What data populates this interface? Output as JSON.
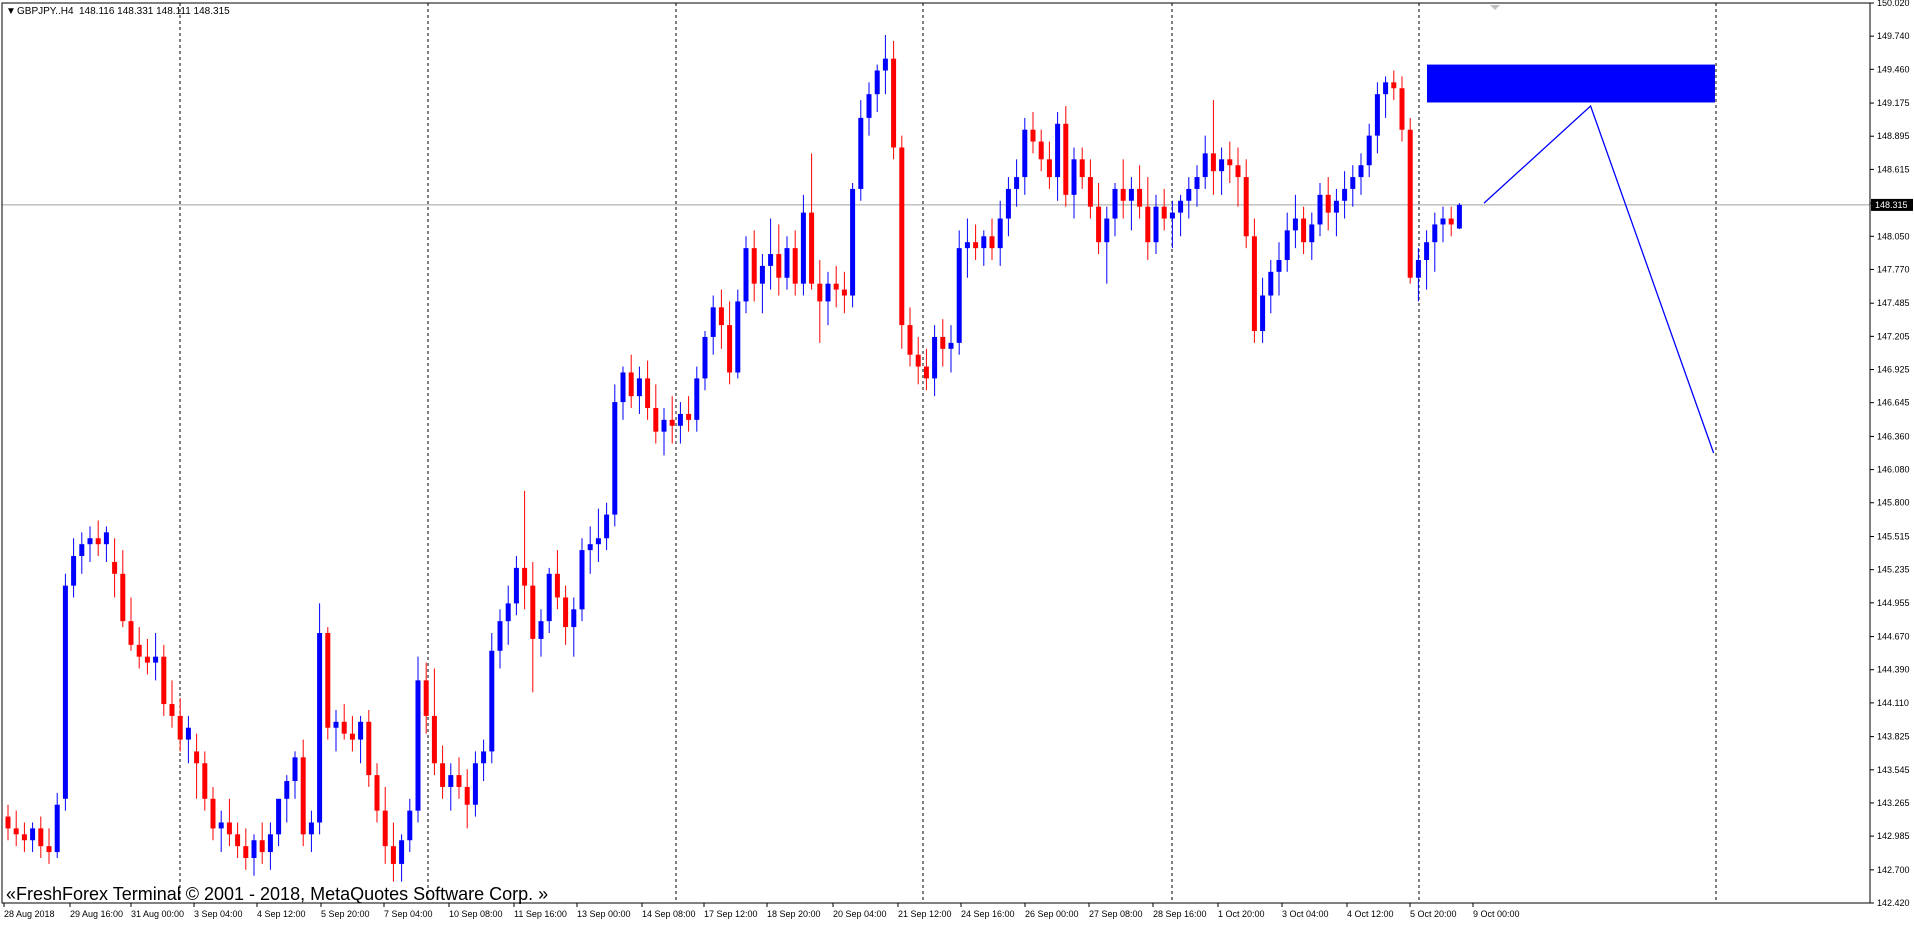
{
  "header": {
    "symbol": "GBPJPY..H4",
    "ohlc": "148.116 148.331 148.111 148.315"
  },
  "copyright": "«FreshForex Terminal © 2001 - 2018, MetaQuotes Software Corp. »",
  "colors": {
    "bull": "#0000ff",
    "bear": "#ff0000",
    "grid": "#000000",
    "bid_line": "#a0a0a0",
    "zone": "#0000ff",
    "forecast": "#0000ff",
    "price_label_bg": "#000000",
    "price_label_fg": "#ffffff"
  },
  "chart_data": {
    "type": "candlestick",
    "timeframe": "H4",
    "ylim": [
      142.42,
      150.02
    ],
    "y_ticks": [
      "150.020",
      "149.740",
      "149.460",
      "149.175",
      "148.895",
      "148.615",
      "148.330",
      "148.050",
      "147.770",
      "147.485",
      "147.205",
      "146.925",
      "146.645",
      "146.360",
      "146.080",
      "145.800",
      "145.515",
      "145.235",
      "144.955",
      "144.670",
      "144.390",
      "144.110",
      "143.825",
      "143.545",
      "143.265",
      "142.985",
      "142.700",
      "142.420"
    ],
    "current_price": "148.315",
    "x_labels": [
      "28 Aug 2018",
      "29 Aug 16:00",
      "31 Aug 00:00",
      "3 Sep 04:00",
      "4 Sep 12:00",
      "5 Sep 20:00",
      "7 Sep 04:00",
      "10 Sep 08:00",
      "11 Sep 16:00",
      "13 Sep 00:00",
      "14 Sep 08:00",
      "17 Sep 12:00",
      "18 Sep 20:00",
      "20 Sep 04:00",
      "21 Sep 12:00",
      "24 Sep 16:00",
      "26 Sep 00:00",
      "27 Sep 08:00",
      "28 Sep 16:00",
      "1 Oct 20:00",
      "3 Oct 04:00",
      "4 Oct 12:00",
      "5 Oct 20:00",
      "9 Oct 00:00"
    ],
    "candles": [
      [
        143.15,
        143.25,
        142.95,
        143.05
      ],
      [
        143.05,
        143.2,
        142.9,
        143.0
      ],
      [
        143.0,
        143.1,
        142.85,
        142.95
      ],
      [
        142.95,
        143.1,
        142.85,
        143.05
      ],
      [
        143.05,
        143.15,
        142.8,
        142.9
      ],
      [
        142.9,
        143.05,
        142.75,
        142.85
      ],
      [
        142.85,
        143.35,
        142.8,
        143.25
      ],
      [
        143.3,
        145.2,
        143.2,
        145.1
      ],
      [
        145.1,
        145.5,
        145.0,
        145.35
      ],
      [
        145.35,
        145.55,
        145.2,
        145.45
      ],
      [
        145.45,
        145.6,
        145.3,
        145.5
      ],
      [
        145.5,
        145.65,
        145.35,
        145.45
      ],
      [
        145.45,
        145.6,
        145.3,
        145.55
      ],
      [
        145.3,
        145.5,
        145.0,
        145.2
      ],
      [
        145.2,
        145.4,
        144.75,
        144.8
      ],
      [
        144.8,
        145.0,
        144.55,
        144.6
      ],
      [
        144.6,
        144.75,
        144.4,
        144.5
      ],
      [
        144.5,
        144.65,
        144.35,
        144.45
      ],
      [
        144.45,
        144.7,
        144.3,
        144.5
      ],
      [
        144.5,
        144.6,
        144.0,
        144.1
      ],
      [
        144.1,
        144.3,
        143.9,
        144.0
      ],
      [
        144.0,
        144.15,
        143.7,
        143.8
      ],
      [
        143.8,
        144.0,
        143.6,
        143.9
      ],
      [
        143.7,
        143.85,
        143.3,
        143.6
      ],
      [
        143.6,
        143.7,
        143.2,
        143.3
      ],
      [
        143.3,
        143.4,
        142.95,
        143.05
      ],
      [
        143.05,
        143.2,
        142.85,
        143.1
      ],
      [
        143.1,
        143.3,
        142.9,
        143.0
      ],
      [
        143.0,
        143.1,
        142.8,
        142.9
      ],
      [
        142.9,
        143.05,
        142.7,
        142.8
      ],
      [
        142.8,
        143.0,
        142.65,
        142.95
      ],
      [
        142.95,
        143.1,
        142.75,
        142.85
      ],
      [
        142.85,
        143.1,
        142.7,
        143.0
      ],
      [
        143.0,
        143.2,
        142.9,
        143.3
      ],
      [
        143.3,
        143.5,
        143.1,
        143.45
      ],
      [
        143.45,
        143.7,
        143.3,
        143.65
      ],
      [
        143.65,
        143.8,
        142.9,
        143.0
      ],
      [
        143.0,
        143.2,
        142.85,
        143.1
      ],
      [
        143.1,
        144.95,
        143.0,
        144.7
      ],
      [
        144.7,
        144.75,
        143.8,
        143.9
      ],
      [
        143.9,
        144.05,
        143.7,
        143.95
      ],
      [
        143.95,
        144.1,
        143.8,
        143.85
      ],
      [
        143.85,
        144.0,
        143.7,
        143.8
      ],
      [
        143.8,
        144.0,
        143.6,
        143.95
      ],
      [
        143.95,
        144.05,
        143.4,
        143.5
      ],
      [
        143.5,
        143.6,
        143.1,
        143.2
      ],
      [
        143.2,
        143.4,
        142.75,
        142.9
      ],
      [
        142.9,
        143.1,
        142.6,
        142.75
      ],
      [
        142.75,
        143.0,
        142.6,
        142.95
      ],
      [
        142.95,
        143.3,
        142.85,
        143.2
      ],
      [
        143.2,
        144.5,
        143.1,
        144.3
      ],
      [
        144.3,
        144.45,
        143.85,
        144.0
      ],
      [
        144.0,
        144.4,
        143.5,
        143.6
      ],
      [
        143.6,
        143.75,
        143.3,
        143.4
      ],
      [
        143.4,
        143.6,
        143.2,
        143.5
      ],
      [
        143.5,
        143.65,
        143.3,
        143.4
      ],
      [
        143.4,
        143.55,
        143.05,
        143.25
      ],
      [
        143.25,
        143.7,
        143.15,
        143.6
      ],
      [
        143.6,
        143.8,
        143.45,
        143.7
      ],
      [
        143.7,
        144.7,
        143.6,
        144.55
      ],
      [
        144.55,
        144.9,
        144.4,
        144.8
      ],
      [
        144.8,
        145.1,
        144.6,
        144.95
      ],
      [
        144.95,
        145.35,
        144.85,
        145.25
      ],
      [
        145.25,
        145.9,
        144.9,
        145.1
      ],
      [
        145.1,
        145.3,
        144.2,
        144.65
      ],
      [
        144.65,
        144.9,
        144.5,
        144.8
      ],
      [
        144.8,
        145.25,
        144.7,
        145.2
      ],
      [
        145.2,
        145.4,
        144.9,
        145.0
      ],
      [
        145.0,
        145.1,
        144.6,
        144.75
      ],
      [
        144.75,
        145.0,
        144.5,
        144.9
      ],
      [
        144.9,
        145.5,
        144.8,
        145.4
      ],
      [
        145.4,
        145.6,
        145.2,
        145.45
      ],
      [
        145.45,
        145.75,
        145.3,
        145.5
      ],
      [
        145.5,
        145.8,
        145.4,
        145.7
      ],
      [
        145.7,
        146.8,
        145.6,
        146.65
      ],
      [
        146.65,
        146.95,
        146.5,
        146.9
      ],
      [
        146.9,
        147.05,
        146.6,
        146.7
      ],
      [
        146.7,
        146.95,
        146.55,
        146.85
      ],
      [
        146.85,
        147.0,
        146.5,
        146.6
      ],
      [
        146.6,
        146.8,
        146.3,
        146.4
      ],
      [
        146.4,
        146.6,
        146.2,
        146.5
      ],
      [
        146.5,
        146.7,
        146.3,
        146.45
      ],
      [
        146.45,
        146.65,
        146.3,
        146.55
      ],
      [
        146.55,
        146.7,
        146.4,
        146.5
      ],
      [
        146.5,
        146.95,
        146.4,
        146.85
      ],
      [
        146.85,
        147.25,
        146.75,
        147.2
      ],
      [
        147.2,
        147.55,
        147.05,
        147.45
      ],
      [
        147.45,
        147.6,
        147.1,
        147.3
      ],
      [
        147.3,
        147.5,
        146.8,
        146.9
      ],
      [
        146.9,
        147.6,
        146.85,
        147.5
      ],
      [
        147.5,
        148.05,
        147.4,
        147.95
      ],
      [
        147.95,
        148.1,
        147.5,
        147.65
      ],
      [
        147.65,
        147.9,
        147.4,
        147.8
      ],
      [
        147.8,
        148.2,
        147.6,
        147.9
      ],
      [
        147.9,
        148.15,
        147.55,
        147.7
      ],
      [
        147.7,
        148.05,
        147.6,
        147.95
      ],
      [
        147.95,
        148.1,
        147.55,
        147.65
      ],
      [
        147.65,
        148.4,
        147.55,
        148.25
      ],
      [
        148.25,
        148.75,
        147.6,
        147.65
      ],
      [
        147.65,
        147.85,
        147.15,
        147.5
      ],
      [
        147.5,
        147.75,
        147.3,
        147.65
      ],
      [
        147.65,
        147.8,
        147.45,
        147.6
      ],
      [
        147.6,
        147.75,
        147.4,
        147.55
      ],
      [
        147.55,
        148.5,
        147.45,
        148.45
      ],
      [
        148.45,
        149.2,
        148.35,
        149.05
      ],
      [
        149.05,
        149.35,
        148.9,
        149.25
      ],
      [
        149.25,
        149.5,
        149.1,
        149.45
      ],
      [
        149.45,
        149.75,
        149.25,
        149.55
      ],
      [
        149.55,
        149.7,
        148.7,
        148.8
      ],
      [
        148.8,
        148.9,
        147.1,
        147.3
      ],
      [
        147.3,
        147.45,
        146.95,
        147.05
      ],
      [
        147.05,
        147.2,
        146.8,
        146.95
      ],
      [
        146.95,
        147.1,
        146.75,
        146.85
      ],
      [
        146.85,
        147.3,
        146.7,
        147.2
      ],
      [
        147.2,
        147.35,
        146.95,
        147.1
      ],
      [
        147.1,
        147.3,
        146.9,
        147.15
      ],
      [
        147.15,
        148.1,
        147.05,
        147.95
      ],
      [
        147.95,
        148.2,
        147.7,
        148.0
      ],
      [
        148.0,
        148.15,
        147.85,
        147.95
      ],
      [
        147.95,
        148.1,
        147.8,
        148.05
      ],
      [
        148.05,
        148.2,
        147.85,
        147.95
      ],
      [
        147.95,
        148.35,
        147.8,
        148.2
      ],
      [
        148.2,
        148.55,
        148.05,
        148.45
      ],
      [
        148.45,
        148.7,
        148.3,
        148.55
      ],
      [
        148.55,
        149.05,
        148.4,
        148.95
      ],
      [
        148.95,
        149.1,
        148.75,
        148.85
      ],
      [
        148.85,
        148.95,
        148.6,
        148.7
      ],
      [
        148.7,
        148.85,
        148.45,
        148.55
      ],
      [
        148.55,
        149.1,
        148.35,
        149.0
      ],
      [
        149.0,
        149.15,
        148.3,
        148.4
      ],
      [
        148.4,
        148.8,
        148.2,
        148.7
      ],
      [
        148.7,
        148.8,
        148.45,
        148.55
      ],
      [
        148.55,
        148.7,
        148.2,
        148.3
      ],
      [
        148.3,
        148.5,
        147.9,
        148.0
      ],
      [
        148.0,
        148.3,
        147.65,
        148.2
      ],
      [
        148.2,
        148.5,
        148.05,
        148.45
      ],
      [
        148.45,
        148.7,
        148.2,
        148.35
      ],
      [
        148.35,
        148.55,
        148.1,
        148.45
      ],
      [
        148.45,
        148.65,
        148.2,
        148.3
      ],
      [
        148.3,
        148.55,
        147.85,
        148.0
      ],
      [
        148.0,
        148.4,
        147.9,
        148.3
      ],
      [
        148.3,
        148.45,
        148.1,
        148.2
      ],
      [
        148.2,
        148.35,
        147.95,
        148.25
      ],
      [
        148.25,
        148.4,
        148.05,
        148.35
      ],
      [
        148.35,
        148.55,
        148.2,
        148.45
      ],
      [
        148.45,
        148.65,
        148.3,
        148.55
      ],
      [
        148.55,
        148.9,
        148.45,
        148.75
      ],
      [
        148.75,
        149.2,
        148.4,
        148.6
      ],
      [
        148.6,
        148.8,
        148.4,
        148.7
      ],
      [
        148.7,
        148.85,
        148.5,
        148.65
      ],
      [
        148.65,
        148.8,
        148.3,
        148.55
      ],
      [
        148.55,
        148.7,
        147.95,
        148.05
      ],
      [
        148.05,
        148.2,
        147.15,
        147.25
      ],
      [
        147.25,
        147.7,
        147.15,
        147.55
      ],
      [
        147.55,
        147.85,
        147.4,
        147.75
      ],
      [
        147.75,
        148.0,
        147.55,
        147.85
      ],
      [
        147.85,
        148.25,
        147.75,
        148.1
      ],
      [
        148.1,
        148.4,
        147.95,
        148.2
      ],
      [
        148.2,
        148.3,
        147.9,
        148.0
      ],
      [
        148.0,
        148.25,
        147.85,
        148.15
      ],
      [
        148.15,
        148.5,
        148.05,
        148.4
      ],
      [
        148.4,
        148.55,
        148.1,
        148.25
      ],
      [
        148.25,
        148.45,
        148.05,
        148.35
      ],
      [
        148.35,
        148.6,
        148.2,
        148.45
      ],
      [
        148.45,
        148.65,
        148.3,
        148.55
      ],
      [
        148.55,
        148.75,
        148.4,
        148.65
      ],
      [
        148.65,
        149.0,
        148.55,
        148.9
      ],
      [
        148.9,
        149.35,
        148.75,
        149.25
      ],
      [
        149.25,
        149.4,
        149.05,
        149.35
      ],
      [
        149.35,
        149.45,
        149.2,
        149.3
      ],
      [
        149.3,
        149.4,
        148.85,
        148.95
      ],
      [
        148.95,
        149.05,
        147.65,
        147.7
      ],
      [
        147.7,
        147.95,
        147.5,
        147.85
      ],
      [
        147.85,
        148.1,
        147.6,
        148.0
      ],
      [
        148.0,
        148.25,
        147.75,
        148.15
      ],
      [
        148.15,
        148.3,
        148.0,
        148.2
      ],
      [
        148.2,
        148.3,
        148.05,
        148.15
      ],
      [
        148.116,
        148.331,
        148.111,
        148.315
      ]
    ],
    "supply_zone": {
      "upper": 149.5,
      "lower": 149.18
    },
    "forecast_path": [
      {
        "bar": 180,
        "price": 148.33
      },
      {
        "bar": 193,
        "price": 149.15
      },
      {
        "bar": 208,
        "price": 146.22
      }
    ]
  }
}
